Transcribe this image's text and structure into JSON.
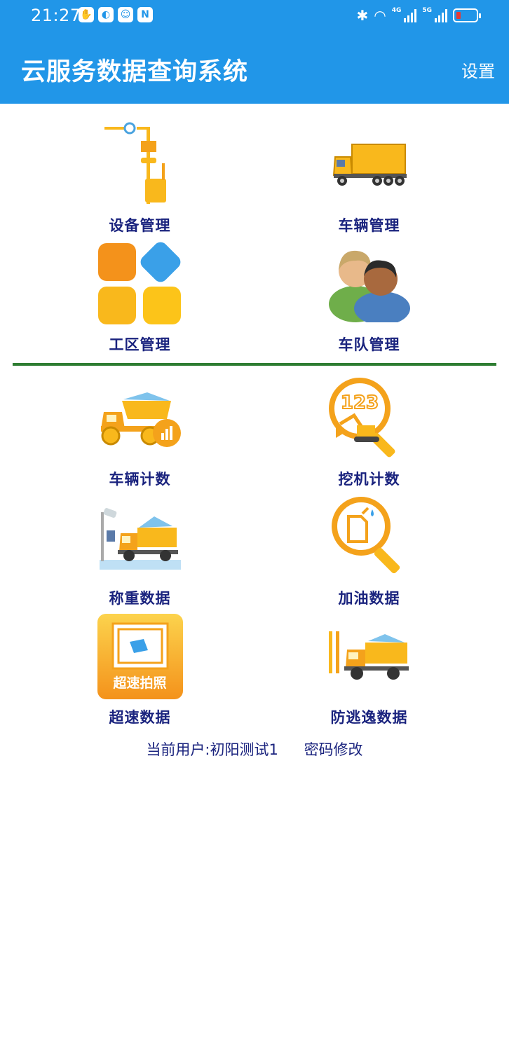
{
  "status_bar": {
    "time": "21:27",
    "net1": "4G",
    "net2": "5G"
  },
  "header": {
    "title": "云服务数据查询系统",
    "settings_label": "设置"
  },
  "management": [
    {
      "label": "设备管理",
      "icon": "device-pole-icon"
    },
    {
      "label": "车辆管理",
      "icon": "truck-icon"
    },
    {
      "label": "工区管理",
      "icon": "tiles-icon"
    },
    {
      "label": "车队管理",
      "icon": "people-icon"
    }
  ],
  "data_menu": [
    {
      "label": "车辆计数",
      "icon": "dump-truck-chart-icon"
    },
    {
      "label": "挖机计数",
      "icon": "excavator-counter-icon"
    },
    {
      "label": "称重数据",
      "icon": "weighbridge-icon"
    },
    {
      "label": "加油数据",
      "icon": "fuel-search-icon"
    },
    {
      "label": "超速数据",
      "icon": "speed-camera-icon",
      "icon_text": "超速拍照"
    },
    {
      "label": "防逃逸数据",
      "icon": "anti-escape-icon"
    }
  ],
  "footer": {
    "user_text": "当前用户:初阳测试1",
    "password_link": "密码修改"
  },
  "colors": {
    "header_bg": "#2196e8",
    "label": "#1a237e",
    "divider": "#2e7d32",
    "accent_yellow": "#f9b81c"
  }
}
